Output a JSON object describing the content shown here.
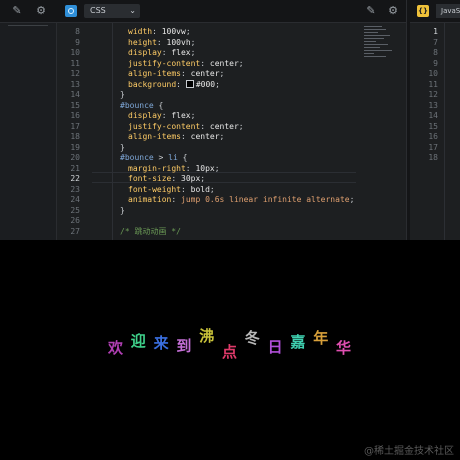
{
  "toolbar": {
    "language": "CSS",
    "right_tab": "JavaS"
  },
  "editor": {
    "lines": [
      {
        "n": "8",
        "html": "<span class=\"k\">width</span><span class=\"punc\">: </span><span class=\"v\">100vw</span><span class=\"punc\">;</span>"
      },
      {
        "n": "9",
        "html": "<span class=\"k\">height</span><span class=\"punc\">: </span><span class=\"v\">100vh</span><span class=\"punc\">;</span>"
      },
      {
        "n": "10",
        "html": "<span class=\"k\">display</span><span class=\"punc\">: </span><span class=\"v\">flex</span><span class=\"punc\">;</span>"
      },
      {
        "n": "11",
        "html": "<span class=\"k\">justify-content</span><span class=\"punc\">: </span><span class=\"v\">center</span><span class=\"punc\">;</span>"
      },
      {
        "n": "12",
        "html": "<span class=\"k\">align-items</span><span class=\"punc\">: </span><span class=\"v\">center</span><span class=\"punc\">;</span>"
      },
      {
        "n": "13",
        "html": "<span class=\"k\">background</span><span class=\"punc\">: </span><span class=\"swatch\"></span><span class=\"v\">#000</span><span class=\"punc\">;</span>"
      },
      {
        "n": "14",
        "html": "<span class=\"punc\">}</span>"
      },
      {
        "n": "15",
        "html": "<span class=\"sel\">#bounce</span><span class=\"punc\"> {</span>"
      },
      {
        "n": "16",
        "html": "<span class=\"k\">display</span><span class=\"punc\">: </span><span class=\"v\">flex</span><span class=\"punc\">;</span>"
      },
      {
        "n": "17",
        "html": "<span class=\"k\">justify-content</span><span class=\"punc\">: </span><span class=\"v\">center</span><span class=\"punc\">;</span>"
      },
      {
        "n": "18",
        "html": "<span class=\"k\">align-items</span><span class=\"punc\">: </span><span class=\"v\">center</span><span class=\"punc\">;</span>"
      },
      {
        "n": "19",
        "html": "<span class=\"punc\">}</span>"
      },
      {
        "n": "20",
        "html": "<span class=\"sel\">#bounce</span><span class=\"punc\"> &gt; </span><span class=\"sel\">li</span><span class=\"punc\"> {</span>"
      },
      {
        "n": "21",
        "html": "<span class=\"k\">margin-right</span><span class=\"punc\">: </span><span class=\"v\">10px</span><span class=\"punc\">;</span>"
      },
      {
        "n": "22",
        "html": "<span class=\"k\">font-size</span><span class=\"punc\">: </span><span class=\"v\">30px</span><span class=\"punc\">;</span>"
      },
      {
        "n": "23",
        "html": "<span class=\"k\">font-weight</span><span class=\"punc\">: </span><span class=\"v\">bold</span><span class=\"punc\">;</span>"
      },
      {
        "n": "24",
        "html": "<span class=\"k\">animation</span><span class=\"punc\">: </span><span class=\"anim\">jump 0.6s linear infinite alternate</span><span class=\"punc\">;</span>"
      },
      {
        "n": "25",
        "html": "<span class=\"punc\">}</span>"
      },
      {
        "n": "26",
        "html": ""
      },
      {
        "n": "27",
        "html": "<span class=\"cm\">/* 跳动动画 */</span>"
      }
    ],
    "active_line": "22",
    "right_lines": [
      "1",
      "7",
      "8",
      "9",
      "10",
      "11",
      "12",
      "13",
      "14",
      "15",
      "16",
      "17",
      "18"
    ],
    "right_active": "1"
  },
  "preview": {
    "letters": [
      {
        "ch": "欢",
        "color": "#b03fb3"
      },
      {
        "ch": "迎",
        "color": "#3fd08a"
      },
      {
        "ch": "来",
        "color": "#3a6fe0"
      },
      {
        "ch": "到",
        "color": "#c46fd6"
      },
      {
        "ch": "沸",
        "color": "#c9c23a"
      },
      {
        "ch": "点",
        "color": "#e03a6a"
      },
      {
        "ch": "冬",
        "color": "#b8b8b8"
      },
      {
        "ch": "日",
        "color": "#b04fd8"
      },
      {
        "ch": "嘉",
        "color": "#3fd0b0"
      },
      {
        "ch": "年",
        "color": "#d8a03a"
      },
      {
        "ch": "华",
        "color": "#e04fb0"
      }
    ],
    "watermark": "@稀土掘金技术社区"
  }
}
